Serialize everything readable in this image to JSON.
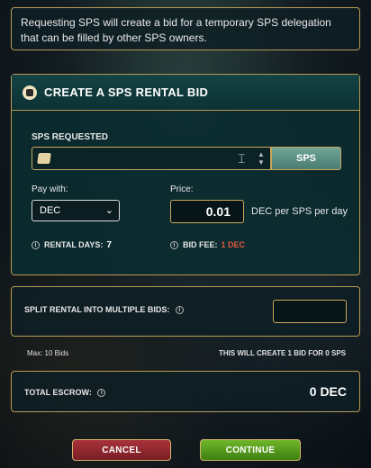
{
  "notice": "Requesting SPS will create a bid for a temporary SPS delegation that can be filled by other SPS owners.",
  "bid": {
    "title": "CREATE A SPS RENTAL BID",
    "sps_requested_label": "SPS REQUESTED",
    "sps_input_value": "",
    "sps_button": "SPS",
    "pay_with_label": "Pay with:",
    "pay_with_value": "DEC",
    "price_label": "Price:",
    "price_value": "0.01",
    "price_unit": "DEC per SPS per day",
    "rental_days_label": "RENTAL DAYS:",
    "rental_days_value": "7",
    "bid_fee_label": "BID FEE:",
    "bid_fee_value": "1 DEC",
    "bid_fee_color": "#e05a3d"
  },
  "split": {
    "label": "SPLIT RENTAL INTO MULTIPLE BIDS:",
    "input_value": ""
  },
  "max_bids": "Max: 10 Bids",
  "will_create": "THIS WILL CREATE 1 BID FOR 0 SPS",
  "escrow": {
    "label": "TOTAL ESCROW:",
    "value": "0 DEC"
  },
  "buttons": {
    "cancel": "CANCEL",
    "continue": "CONTINUE"
  },
  "colors": {
    "border_gold": "#b89a52",
    "cancel_red": "#a7323a",
    "continue_green": "#6fb62a"
  }
}
